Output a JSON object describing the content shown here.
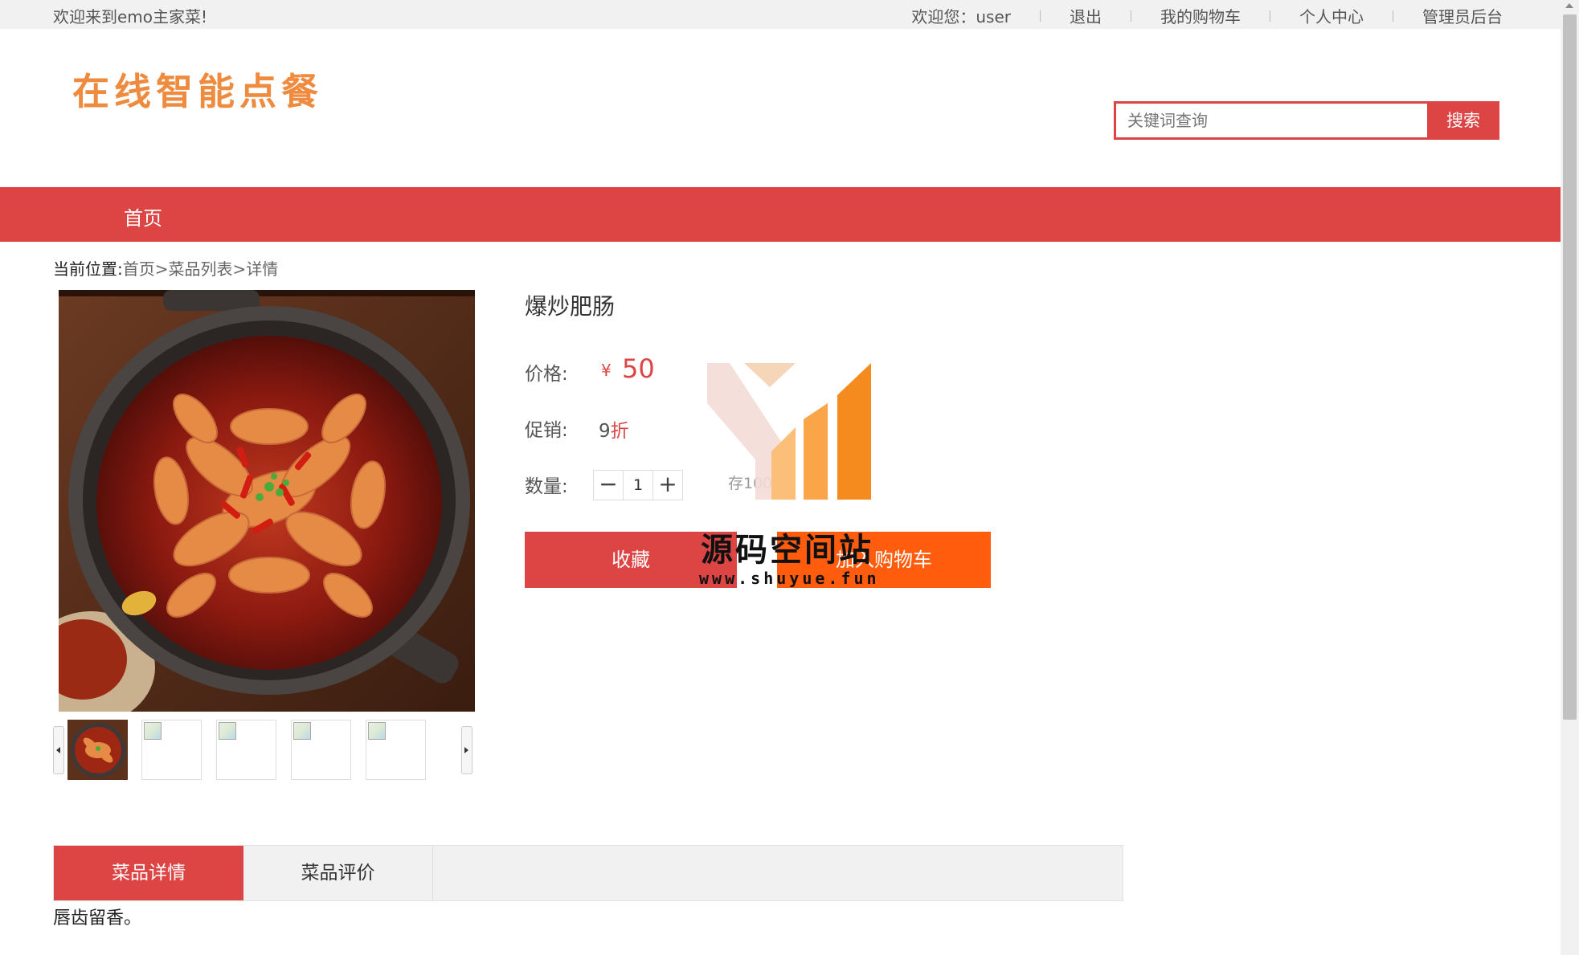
{
  "topbar": {
    "welcome": "欢迎来到emo主家菜!",
    "user_greeting": "欢迎您：user",
    "logout": "退出",
    "cart": "我的购物车",
    "profile": "个人中心",
    "admin": "管理员后台"
  },
  "header": {
    "logo_text": "在线智能点餐",
    "search_placeholder": "关键词查询",
    "search_button": "搜索"
  },
  "nav": {
    "home": "首页"
  },
  "breadcrumb": {
    "label": "当前位置:",
    "home": "首页",
    "sep": ">",
    "list": "菜品列表",
    "current": "详情"
  },
  "product": {
    "name": "爆炒肥肠",
    "price_label": "价格:",
    "currency": "¥",
    "price": "50",
    "promo_label": "促销:",
    "promo_value": "9",
    "promo_unit": "折",
    "qty_label": "数量:",
    "qty_minus": "−",
    "qty_value": "1",
    "qty_plus": "+",
    "stock_text": "存100件",
    "fav_button": "收藏",
    "cart_button": "加入购物车"
  },
  "watermark": {
    "title": "源码空间站",
    "url": "www.shuyue.fun"
  },
  "tabs": [
    {
      "label": "菜品详情"
    },
    {
      "label": "菜品评价"
    }
  ],
  "detail_text": "唇齿留香。",
  "colors": {
    "brand_red": "#dd4444",
    "cart_orange": "#ff5c0e",
    "logo_orange": "#ef8b3f"
  }
}
